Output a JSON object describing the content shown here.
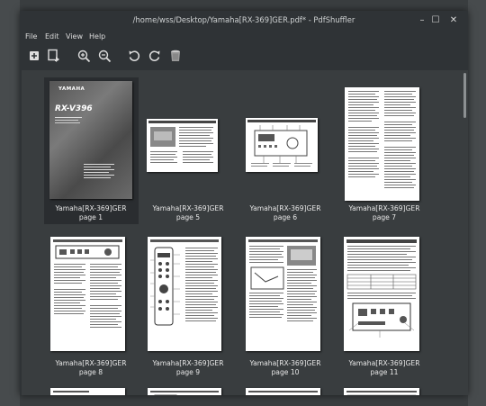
{
  "window": {
    "title": "/home/wss/Desktop/Yamaha[RX-369]GER.pdf* - PdfShuffler",
    "controls": {
      "minimize": "–",
      "maximize": "☐",
      "close": "✕"
    }
  },
  "menu": [
    "File",
    "Edit",
    "View",
    "Help"
  ],
  "toolbar": {
    "buttons": [
      "add-icon",
      "export-icon",
      "zoom-in-icon",
      "zoom-out-icon",
      "rotate-left-icon",
      "rotate-right-icon",
      "delete-icon"
    ]
  },
  "pages": [
    {
      "file": "Yamaha[RX-369]GER",
      "page": "page 1"
    },
    {
      "file": "Yamaha[RX-369]GER",
      "page": "page 5"
    },
    {
      "file": "Yamaha[RX-369]GER",
      "page": "page 6"
    },
    {
      "file": "Yamaha[RX-369]GER",
      "page": "page 7"
    },
    {
      "file": "Yamaha[RX-369]GER",
      "page": "page 8"
    },
    {
      "file": "Yamaha[RX-369]GER",
      "page": "page 9"
    },
    {
      "file": "Yamaha[RX-369]GER",
      "page": "page 10"
    },
    {
      "file": "Yamaha[RX-369]GER",
      "page": "page 11"
    }
  ],
  "cover": {
    "brand": "YAMAHA",
    "model": "RX-V396"
  }
}
